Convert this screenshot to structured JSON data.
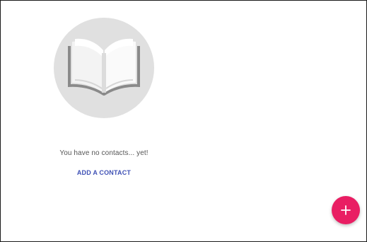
{
  "empty_state": {
    "illustration_icon": "open-book-icon",
    "message": "You have no contacts... yet!",
    "action_label": "ADD A CONTACT"
  },
  "fab": {
    "icon": "plus-icon"
  },
  "colors": {
    "illustration_bg": "#e0e0e0",
    "link": "#3f51b5",
    "fab": "#e91e63",
    "text": "#555555"
  }
}
